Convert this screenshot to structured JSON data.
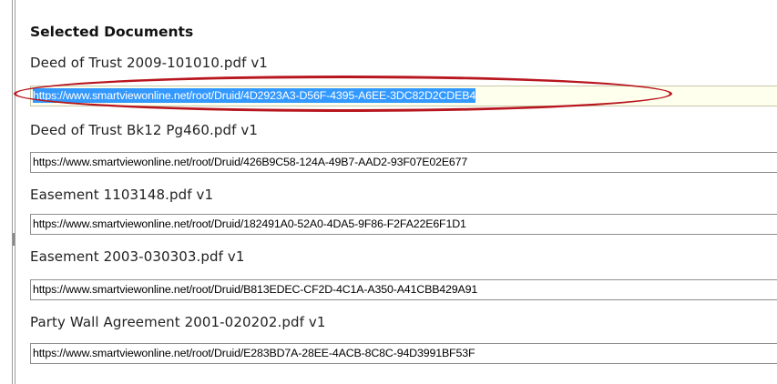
{
  "section_title": "Selected Documents",
  "documents": [
    {
      "name": "Deed of Trust 2009-101010.pdf v1",
      "url": "https://www.smartviewonline.net/root/Druid/4D2923A3-D56F-4395-A6EE-3DC82D2CDEB4",
      "selected": true
    },
    {
      "name": "Deed of Trust Bk12 Pg460.pdf v1",
      "url": "https://www.smartviewonline.net/root/Druid/426B9C58-124A-49B7-AAD2-93F07E02E677",
      "selected": false
    },
    {
      "name": "Easement 1103148.pdf v1",
      "url": "https://www.smartviewonline.net/root/Druid/182491A0-52A0-4DA5-9F86-F2FA22E6F1D1",
      "selected": false
    },
    {
      "name": "Easement 2003-030303.pdf v1",
      "url": "https://www.smartviewonline.net/root/Druid/B813EDEC-CF2D-4C1A-A350-A41CBB429A91",
      "selected": false
    },
    {
      "name": "Party Wall Agreement 2001-020202.pdf v1",
      "url": "https://www.smartviewonline.net/root/Druid/E283BD7A-28EE-4ACB-8C8C-94D3991BF53F",
      "selected": false
    }
  ],
  "annotation": {
    "color": "#b8161e"
  },
  "colors": {
    "selection": "#3399ff",
    "active_field_bg": "#ffffee"
  }
}
